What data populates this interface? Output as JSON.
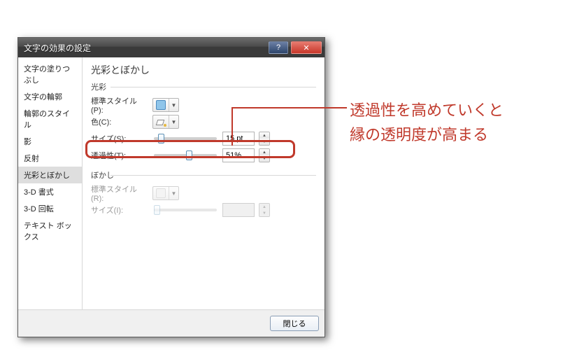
{
  "dialog": {
    "title": "文字の効果の設定"
  },
  "sidebar": {
    "items": [
      {
        "label": "文字の塗りつぶし"
      },
      {
        "label": "文字の輪郭"
      },
      {
        "label": "輪郭のスタイル"
      },
      {
        "label": "影"
      },
      {
        "label": "反射"
      },
      {
        "label": "光彩とぼかし"
      },
      {
        "label": "3-D 書式"
      },
      {
        "label": "3-D 回転"
      },
      {
        "label": "テキスト ボックス"
      }
    ],
    "selected_index": 5
  },
  "main": {
    "title": "光彩とぼかし",
    "glow": {
      "group_label": "光彩",
      "preset_label": "標準スタイル(P):",
      "color_label": "色(C):",
      "size_label": "サイズ(S):",
      "size_value": "15 pt",
      "size_slider_percent": 7,
      "transparency_label": "透過性(T):",
      "transparency_value": "51%",
      "transparency_slider_percent": 51
    },
    "blur": {
      "group_label": "ぼかし",
      "preset_label": "標準スタイル(R):",
      "size_label": "サイズ(I):",
      "size_value": "",
      "size_slider_percent": 0
    }
  },
  "footer": {
    "close_label": "閉じる"
  },
  "annotation": {
    "text": "透過性を高めていくと\n縁の透明度が高まる"
  }
}
